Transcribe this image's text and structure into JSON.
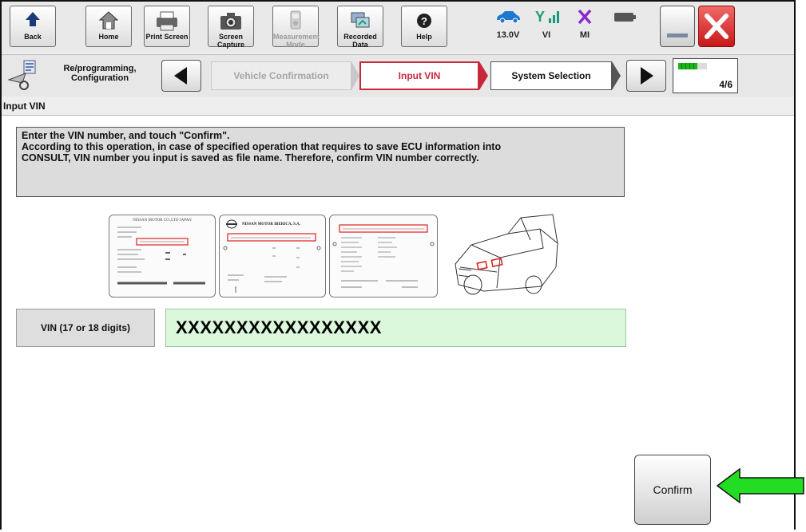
{
  "toolbar": {
    "back_label": "Back",
    "home_label": "Home",
    "print_label": "Print Screen",
    "capture_label": "Screen Capture",
    "measure_label": "Measurement Mode",
    "recorded_label": "Recorded Data",
    "help_label": "Help",
    "voltage": "13.0V",
    "vi_label": "VI",
    "mi_label": "MI"
  },
  "nav": {
    "mode_label": "Re/programming, Configuration",
    "steps": [
      {
        "label": "Vehicle Confirmation",
        "state": "done"
      },
      {
        "label": "Input VIN",
        "state": "active"
      },
      {
        "label": "System Selection",
        "state": "next"
      }
    ],
    "progress": {
      "current": 4,
      "total": 6,
      "text": "4/6"
    }
  },
  "screen_title": "Input VIN",
  "instructions": [
    "Enter the VIN number, and touch \"Confirm\".",
    "According to this operation, in case of specified operation that requires to save ECU information into",
    "CONSULT, VIN number you input is saved as file name. Therefore, confirm VIN number correctly."
  ],
  "plates": {
    "plate1_header": "NISSAN MOTOR CO.,LTD JAPAN",
    "plate2_header": "NISSAN MOTOR IBERICA, S.A."
  },
  "vin": {
    "label": "VIN (17 or 18 digits)",
    "value": "XXXXXXXXXXXXXXXXX"
  },
  "confirm_label": "Confirm",
  "colors": {
    "accent_red": "#c8283c",
    "vin_field_bg": "#dcf8dc",
    "arrow_green": "#22dd22",
    "progress_green": "#19b619"
  }
}
